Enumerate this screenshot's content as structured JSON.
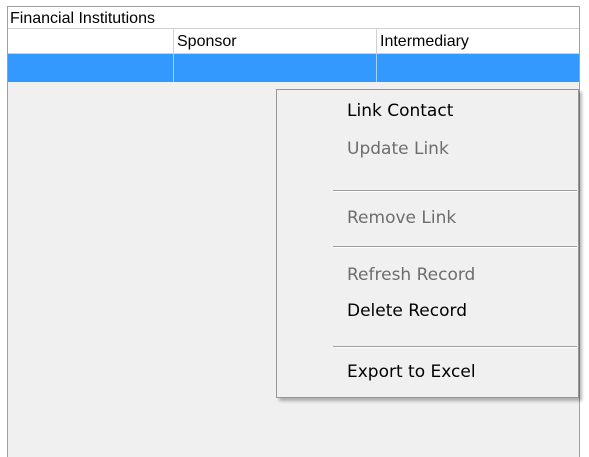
{
  "grid": {
    "band_title": "Financial Institutions",
    "columns": [
      "",
      "Sponsor",
      "Intermediary"
    ],
    "selected_row_color": "#3399ff"
  },
  "context_menu": {
    "items": [
      {
        "label": "Link Contact",
        "enabled": true
      },
      {
        "label": "Update Link",
        "enabled": false
      },
      {
        "label": "Remove Link",
        "enabled": false
      },
      {
        "label": "Refresh Record",
        "enabled": false
      },
      {
        "label": "Delete Record",
        "enabled": true
      },
      {
        "label": "Export to Excel",
        "enabled": true
      }
    ]
  }
}
